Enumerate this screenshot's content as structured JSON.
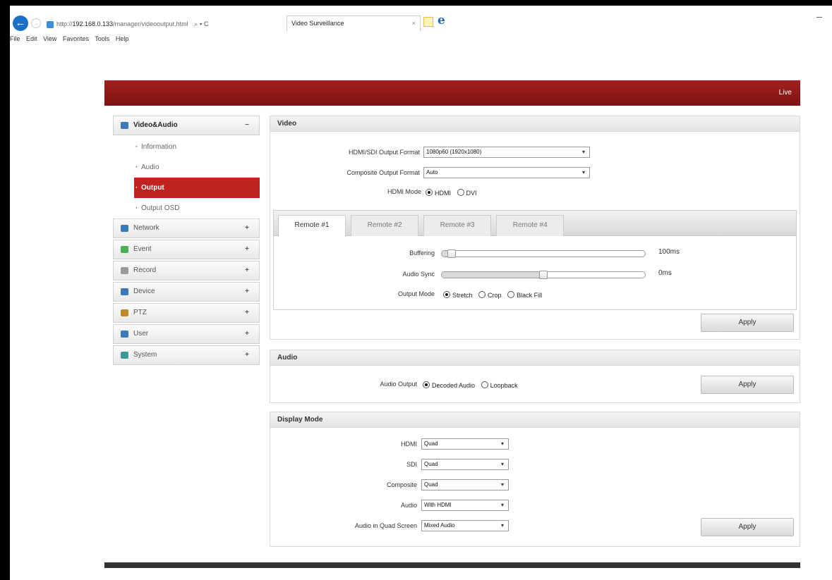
{
  "browser": {
    "url_prefix": "http://",
    "url_host": "192.168.0.133",
    "url_path": "/manager/videooutput.html",
    "addr_controls": "⌕ ▾ C",
    "tab_title": "Video Surveillance",
    "tab_close": "×",
    "menu": [
      "File",
      "Edit",
      "View",
      "Favorites",
      "Tools",
      "Help"
    ]
  },
  "header": {
    "live_label": "Live"
  },
  "sidebar": {
    "groups": [
      {
        "label": "Video&Audio",
        "toggle": "−",
        "icon": "video-icon",
        "color": "#3a7ab8"
      },
      {
        "label": "Network",
        "toggle": "+",
        "icon": "network-icon",
        "color": "#3a7ab8"
      },
      {
        "label": "Event",
        "toggle": "+",
        "icon": "event-icon",
        "color": "#4caf50"
      },
      {
        "label": "Record",
        "toggle": "+",
        "icon": "record-icon",
        "color": "#999999"
      },
      {
        "label": "Device",
        "toggle": "+",
        "icon": "device-icon",
        "color": "#3a7ab8"
      },
      {
        "label": "PTZ",
        "toggle": "+",
        "icon": "ptz-icon",
        "color": "#c08a2a"
      },
      {
        "label": "User",
        "toggle": "+",
        "icon": "user-icon",
        "color": "#3a7ab8"
      },
      {
        "label": "System",
        "toggle": "+",
        "icon": "system-icon",
        "color": "#3a9a9a"
      }
    ],
    "subitems": [
      "Information",
      "Audio",
      "Output",
      "Output OSD"
    ],
    "active_subitem": "Output"
  },
  "video": {
    "title": "Video",
    "hdmi_sdi_label": "HDMI/SDI Output Format",
    "hdmi_sdi_value": "1080p60 (1920x1080)",
    "composite_label": "Composite Output Format",
    "composite_value": "Auto",
    "hdmi_mode_label": "HDMI Mode",
    "hdmi_mode_options": [
      "HDMI",
      "DVI"
    ],
    "hdmi_mode_selected": "HDMI",
    "tabs": [
      "Remote #1",
      "Remote #2",
      "Remote #3",
      "Remote #4"
    ],
    "selected_tab": "Remote #1",
    "buffering_label": "Buffering",
    "buffering_value": "100ms",
    "buffering_level": 0.03,
    "audio_sync_label": "Audio Sync",
    "audio_sync_value": "0ms",
    "audio_sync_level": 0.5,
    "output_mode_label": "Output Mode",
    "output_mode_options": [
      "Stretch",
      "Crop",
      "Black Fill"
    ],
    "output_mode_selected": "Stretch",
    "apply_label": "Apply"
  },
  "audio": {
    "title": "Audio",
    "output_label": "Audio Output",
    "output_options": [
      "Decoded Audio",
      "Loopback"
    ],
    "output_selected": "Decoded Audio",
    "apply_label": "Apply"
  },
  "display": {
    "title": "Display Mode",
    "rows": [
      {
        "label": "HDMI",
        "value": "Quad"
      },
      {
        "label": "SDI",
        "value": "Quad"
      },
      {
        "label": "Composite",
        "value": "Quad"
      },
      {
        "label": "Audio",
        "value": "With HDMI"
      },
      {
        "label": "Audio in Quad Screen",
        "value": "Mixed Audio"
      }
    ],
    "apply_label": "Apply"
  },
  "icons": {
    "caret": "▾",
    "back": "←",
    "forward": "→"
  }
}
